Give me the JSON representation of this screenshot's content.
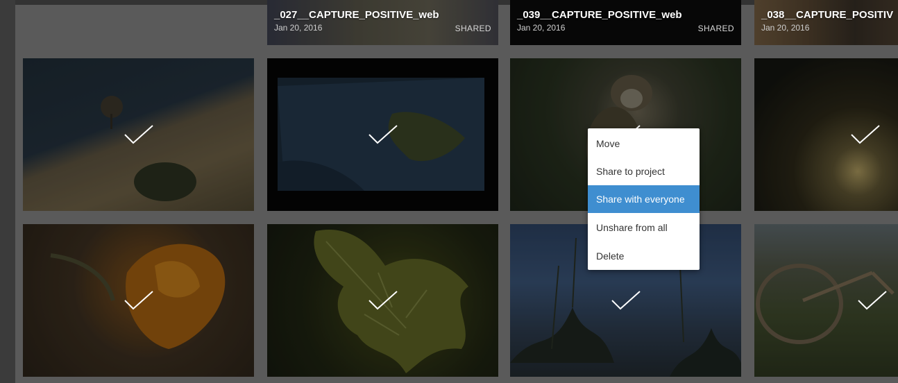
{
  "top_row": [
    {
      "title": "_027__CAPTURE_POSITIVE_web",
      "date": "Jan 20, 2016",
      "status": "SHARED"
    },
    {
      "title": "_039__CAPTURE_POSITIVE_web",
      "date": "Jan 20, 2016",
      "status": "SHARED"
    },
    {
      "title": "_038__CAPTURE_POSITIV",
      "date": "Jan 20, 2016",
      "status": ""
    }
  ],
  "grid_tiles": [
    {
      "subject": "hillside-tree",
      "selected": true
    },
    {
      "subject": "earth-from-space",
      "selected": true
    },
    {
      "subject": "squirrel-monkey",
      "selected": true
    },
    {
      "subject": "sunset-plants",
      "selected": true
    },
    {
      "subject": "orange-poppy",
      "selected": true
    },
    {
      "subject": "backlit-leaf",
      "selected": true
    },
    {
      "subject": "plants-against-sky",
      "selected": true
    },
    {
      "subject": "bicycle-in-grass",
      "selected": true
    }
  ],
  "context_menu": {
    "items": [
      "Move",
      "Share to project",
      "Share with everyone",
      "Unshare from all",
      "Delete"
    ],
    "highlighted": "Share with everyone"
  },
  "colors": {
    "menu_highlight": "#3f8ed0",
    "background": "#5a5a5a",
    "checkmark": "#ffffff"
  },
  "icons": {
    "selection": "checkmark-icon"
  }
}
